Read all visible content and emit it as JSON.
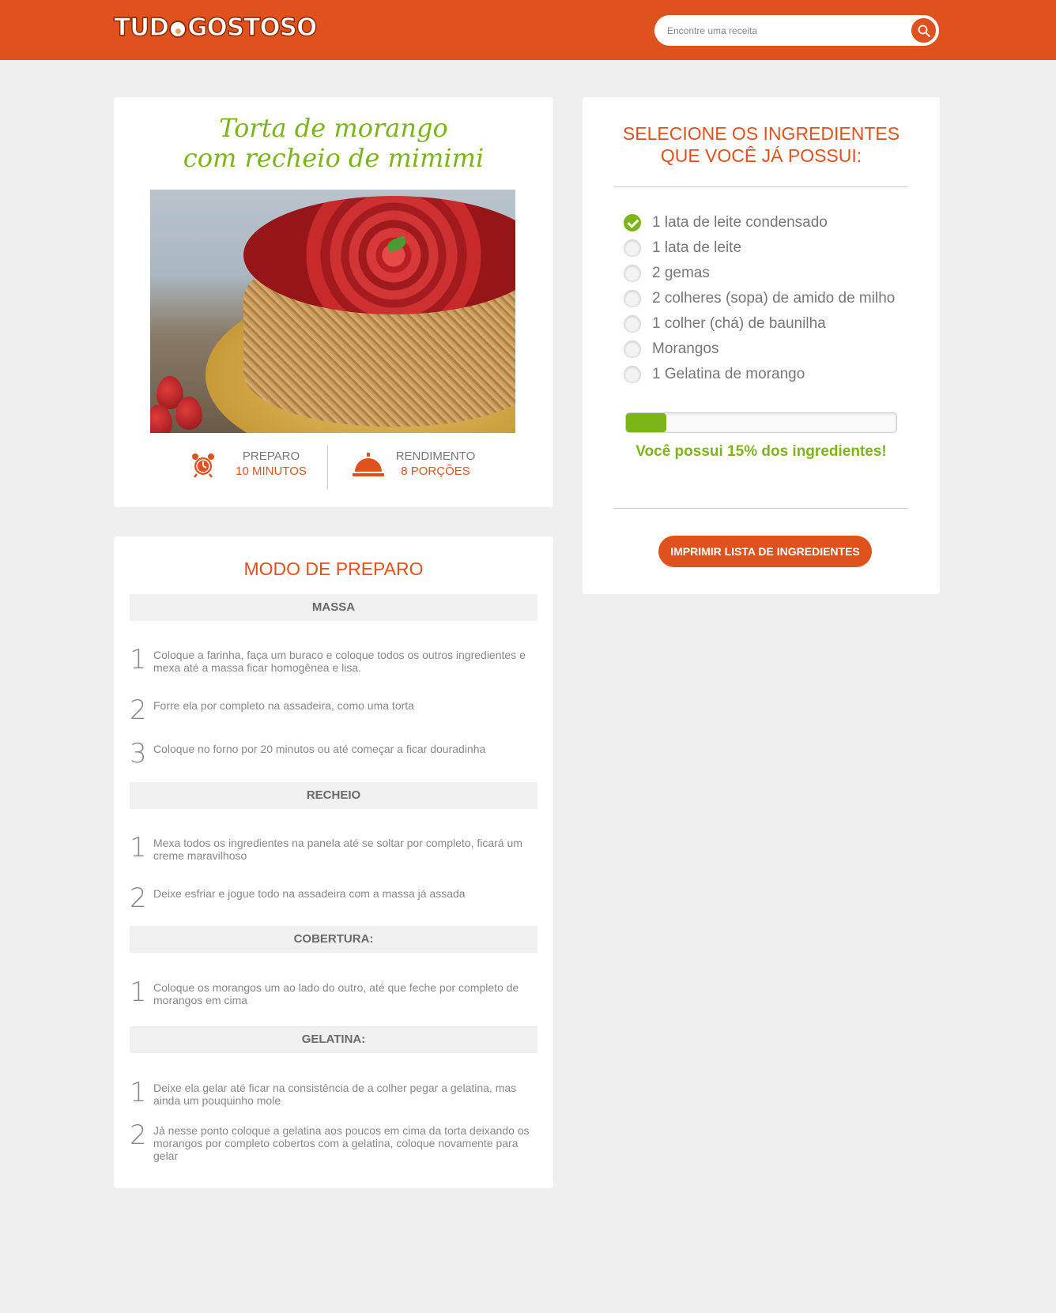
{
  "header": {
    "logo_text_left": "TUD",
    "logo_text_right": "GOSTOSO",
    "search_placeholder": "Encontre uma receita",
    "brand_color": "#e0521d"
  },
  "recipe": {
    "title_line1": "Torta de morango",
    "title_line2": "com recheio de mimimi",
    "prep_label": "PREPARO",
    "prep_value": "10 MINUTOS",
    "yield_label": "RENDIMENTO",
    "yield_value": "8 PORÇÕES"
  },
  "steps": {
    "title": "MODO DE PREPARO",
    "sections": [
      {
        "header": "MASSA",
        "items": [
          {
            "num": "1",
            "text": "Coloque a farinha, faça um buraco e coloque todos os outros ingredientes e mexa até a massa ficar homogênea e lisa."
          },
          {
            "num": "2",
            "text": "Forre ela por completo na assadeira, como uma torta"
          },
          {
            "num": "3",
            "text": "Coloque no forno por 20 minutos ou até começar a ficar douradinha"
          }
        ]
      },
      {
        "header": "RECHEIO",
        "items": [
          {
            "num": "1",
            "text": "Mexa todos os ingredientes na panela até se soltar por completo, ficará um creme maravilhoso"
          },
          {
            "num": "2",
            "text": "Deixe esfriar e jogue todo na assadeira com a massa já assada"
          }
        ]
      },
      {
        "header": "COBERTURA:",
        "items": [
          {
            "num": "1",
            "text": "Coloque os morangos um ao lado do outro, até que feche por completo de morangos em cima"
          }
        ]
      },
      {
        "header": "GELATINA:",
        "items": [
          {
            "num": "1",
            "text": "Deixe ela gelar até ficar na consistência de a colher pegar a gelatina, mas ainda um pouquinho mole"
          },
          {
            "num": "2",
            "text": "Já nesse ponto coloque a gelatina aos poucos em cima da torta deixando os morangos por completo cobertos com a gelatina, coloque novamente para gelar"
          }
        ]
      }
    ]
  },
  "ingredients": {
    "title_line1": "SELECIONE OS INGREDIENTES",
    "title_line2": "QUE VOCÊ JÁ POSSUI:",
    "items": [
      {
        "label": "1 lata de leite condensado",
        "checked": true
      },
      {
        "label": "1 lata de leite",
        "checked": false
      },
      {
        "label": "2 gemas",
        "checked": false
      },
      {
        "label": "2 colheres (sopa) de amido de milho",
        "checked": false
      },
      {
        "label": "1 colher (chá) de baunilha",
        "checked": false
      },
      {
        "label": "Morangos",
        "checked": false
      },
      {
        "label": "1 Gelatina de morango",
        "checked": false
      }
    ],
    "progress_percent": 15,
    "progress_text": "Você possui 15% dos ingredientes!",
    "print_button": "IMPRIMIR LISTA DE INGREDIENTES",
    "accent_green": "#7cb518"
  }
}
